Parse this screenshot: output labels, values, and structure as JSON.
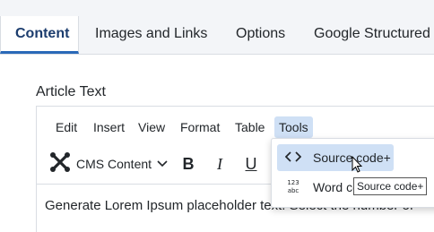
{
  "tabs": [
    {
      "label": "Content",
      "active": true
    },
    {
      "label": "Images and Links"
    },
    {
      "label": "Options"
    },
    {
      "label": "Google Structured"
    }
  ],
  "field": {
    "label": "Article Text"
  },
  "editor": {
    "menu": [
      "Edit",
      "Insert",
      "View",
      "Format",
      "Table",
      "Tools"
    ],
    "open_menu": "Tools",
    "toolbar": {
      "cms_label": "CMS Content",
      "bold": "B",
      "italic": "I",
      "underline": "U"
    },
    "content_text": "Generate Lorem Ipsum placeholder text. Select the number of"
  },
  "dropdown": {
    "items": [
      {
        "label": "Source code+",
        "icon": "source-code-icon",
        "highlighted": true
      },
      {
        "label": "Word co",
        "icon": "word-count-icon",
        "icon_text": "123\nabc"
      }
    ]
  },
  "tooltip": "Source code+",
  "colors": {
    "accent": "#2a69b8",
    "highlight": "#cfe0f5",
    "tab_active_text": "#1c3d6e"
  }
}
